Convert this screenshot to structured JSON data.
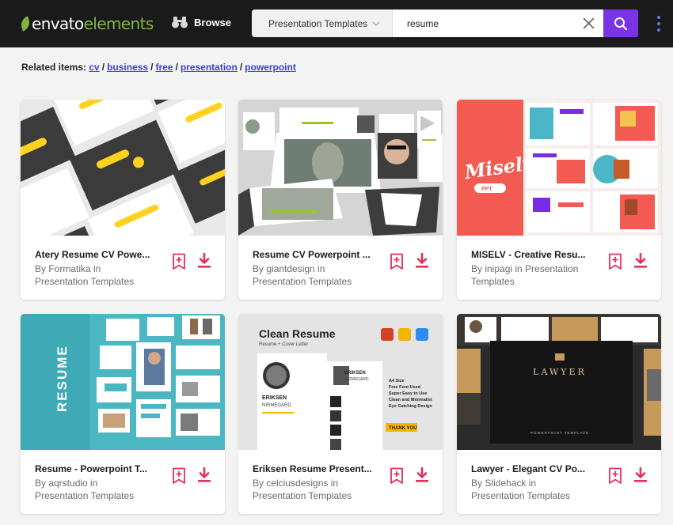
{
  "header": {
    "logo_text": "envato",
    "logo_text2": "elements",
    "browse_label": "Browse",
    "category_label": "Presentation Templates",
    "search_value": "resume",
    "search_placeholder": "Search"
  },
  "related": {
    "label": "Related items:",
    "items": [
      "cv",
      "business",
      "free",
      "presentation",
      "powerpoint"
    ]
  },
  "colors": {
    "accent": "#7b33e8",
    "brand_green": "#82b540",
    "action_red": "#e2315a",
    "link": "#3d3dd8"
  },
  "cards": [
    {
      "title": "Atery Resume CV Powe...",
      "by": "By Formatika in",
      "category": "Presentation Templates"
    },
    {
      "title": "Resume CV Powerpoint ...",
      "by": "By giantdesign in",
      "category": "Presentation Templates"
    },
    {
      "title": "MISELV - Creative Resu...",
      "by": "By inipagi in Presentation",
      "category": "Templates"
    },
    {
      "title": "Resume - Powerpoint T...",
      "by": "By aqrstudio in",
      "category": "Presentation Templates"
    },
    {
      "title": "Eriksen Resume Present...",
      "by": "By celciusdesigns in",
      "category": "Presentation Templates"
    },
    {
      "title": "Lawyer - Elegant CV Po...",
      "by": "By Slidehack in",
      "category": "Presentation Templates"
    }
  ],
  "thumbnails": {
    "t3_word": "Miselv",
    "t3_badge": "PPT",
    "t4_word": "RESUME",
    "t5_title": "Clean Resume",
    "t5_subtitle": "Resume + Cover Letter",
    "t5_name": "ERIKSEN",
    "t5_surname": "NIRMEGARD",
    "t5_features": [
      "A4 Size",
      "Free Font Used",
      "Super Easy to Use",
      "Clean and Minimalist",
      "Eye Catching Design"
    ],
    "t5_button": "THANK YOU",
    "t6_title": "LAWYER",
    "t6_subtitle": "POWERPOINT TEMPLATE"
  }
}
